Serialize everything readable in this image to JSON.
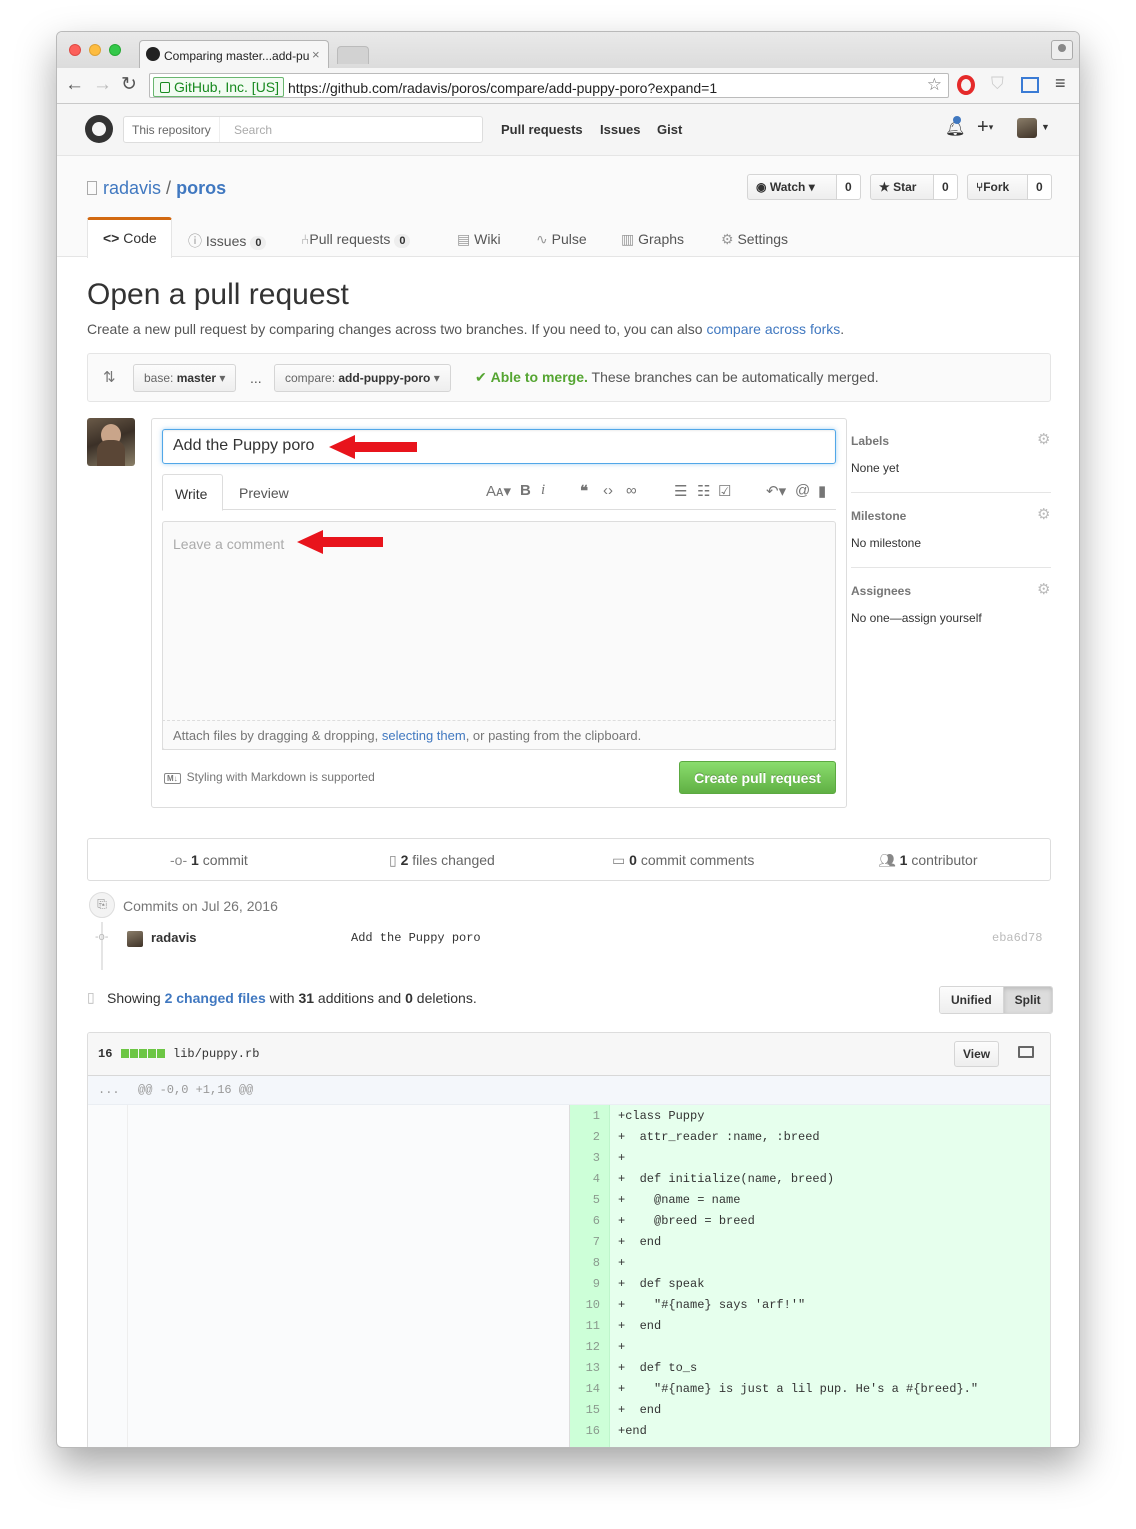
{
  "browser": {
    "tab_title": "Comparing master...add-pu",
    "cert": "GitHub, Inc. [US]",
    "url": "https://github.com/radavis/poros/compare/add-puppy-poro?expand=1"
  },
  "header": {
    "scope_label": "This repository",
    "search_placeholder": "Search",
    "nav": [
      "Pull requests",
      "Issues",
      "Gist"
    ],
    "plus": "+"
  },
  "repo": {
    "owner": "radavis",
    "sep": "/",
    "name": "poros",
    "watch_label": "Watch",
    "watch_count": "0",
    "star_label": "Star",
    "star_count": "0",
    "fork_label": "Fork",
    "fork_count": "0",
    "tabs": {
      "code": "Code",
      "issues": "Issues",
      "issues_count": "0",
      "pulls": "Pull requests",
      "pulls_count": "0",
      "wiki": "Wiki",
      "pulse": "Pulse",
      "graphs": "Graphs",
      "settings": "Settings"
    }
  },
  "page": {
    "title": "Open a pull request",
    "subtitle": "Create a new pull request by comparing changes across two branches. If you need to, you can also ",
    "subtitle_link": "compare across forks",
    "subtitle_end": "."
  },
  "range": {
    "base_prefix": "base:",
    "base": "master",
    "dots": "...",
    "compare_prefix": "compare:",
    "compare": "add-puppy-poro",
    "merge_status": "Able to merge.",
    "merge_note": "These branches can be automatically merged."
  },
  "form": {
    "title_value": "Add the Puppy poro",
    "write_tab": "Write",
    "preview_tab": "Preview",
    "comment_placeholder": "Leave a comment",
    "attach_text": "Attach files by dragging & dropping, ",
    "attach_link": "selecting them",
    "attach_end": ", or pasting from the clipboard.",
    "markdown_note": "Styling with Markdown is supported",
    "submit": "Create pull request"
  },
  "sidebar": {
    "labels_h": "Labels",
    "labels_v": "None yet",
    "milestone_h": "Milestone",
    "milestone_v": "No milestone",
    "assignees_h": "Assignees",
    "assignees_v": "No one—assign yourself"
  },
  "summary": {
    "commits_n": "1",
    "commits": "commit",
    "files_n": "2",
    "files": "files changed",
    "comments_n": "0",
    "comments": "commit comments",
    "contrib_n": "1",
    "contrib": "contributor"
  },
  "commits": {
    "heading": "Commits on Jul 26, 2016",
    "author": "radavis",
    "message": "Add the Puppy poro",
    "sha": "eba6d78"
  },
  "diffstat": {
    "showing": "Showing ",
    "changed": "2 changed files",
    "with": " with ",
    "additions_n": "31",
    "additions": " additions and ",
    "deletions_n": "0",
    "deletions": " deletions.",
    "unified": "Unified",
    "split": "Split"
  },
  "file": {
    "count": "16",
    "path": "lib/puppy.rb",
    "view": "View",
    "hunk_dots": "...",
    "hunk": "@@ -0,0 +1,16 @@",
    "lines": [
      "+class Puppy",
      "+  attr_reader :name, :breed",
      "+",
      "+  def initialize(name, breed)",
      "+    @name = name",
      "+    @breed = breed",
      "+  end",
      "+",
      "+  def speak",
      "+    \"#{name} says 'arf!'\"",
      "+  end",
      "+",
      "+  def to_s",
      "+    \"#{name} is just a lil pup. He's a #{breed}.\"",
      "+  end",
      "+end"
    ]
  },
  "colors": {
    "link": "#4078c0",
    "green": "#55a532",
    "annotation_arrow": "#e8141c"
  }
}
